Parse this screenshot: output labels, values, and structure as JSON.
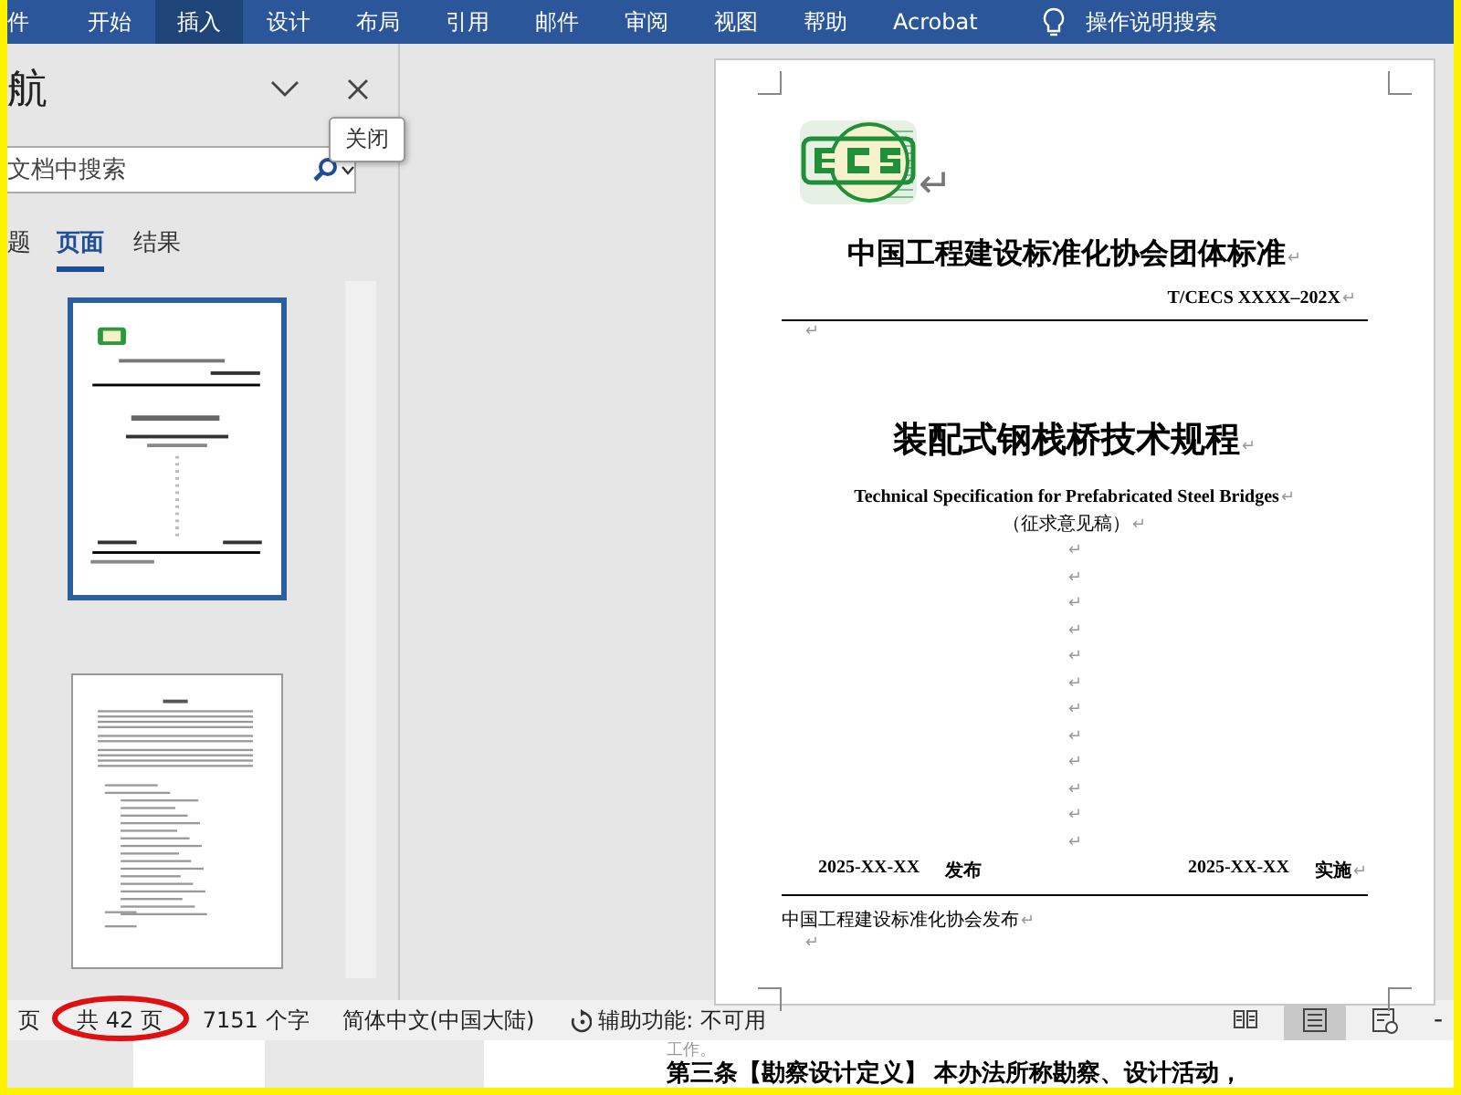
{
  "ribbon": {
    "tabs": [
      {
        "label": "件",
        "selected": false
      },
      {
        "label": "开始",
        "selected": false
      },
      {
        "label": "插入",
        "selected": true
      },
      {
        "label": "设计",
        "selected": false
      },
      {
        "label": "布局",
        "selected": false
      },
      {
        "label": "引用",
        "selected": false
      },
      {
        "label": "邮件",
        "selected": false
      },
      {
        "label": "审阅",
        "selected": false
      },
      {
        "label": "视图",
        "selected": false
      },
      {
        "label": "帮助",
        "selected": false
      },
      {
        "label": "Acrobat",
        "selected": false
      }
    ],
    "tell_me": "操作说明搜索"
  },
  "navigation": {
    "title": "航",
    "tooltip": "关闭",
    "search": {
      "placeholder": "文档中搜索"
    },
    "tabs": [
      {
        "label": "题",
        "selected": false
      },
      {
        "label": "页面",
        "selected": true
      },
      {
        "label": "结果",
        "selected": false
      }
    ],
    "thumbnails": [
      {
        "kind": "cover",
        "selected": true
      },
      {
        "kind": "text",
        "selected": false
      }
    ]
  },
  "document": {
    "paragraphs": [
      {
        "kind": "logo",
        "mark": "↵"
      },
      {
        "kind": "org",
        "text": "中国工程建设标准化协会团体标准",
        "mark": "↵"
      },
      {
        "kind": "code",
        "text": "T/CECS XXXX–202X",
        "mark": "↵"
      },
      {
        "kind": "rule"
      },
      {
        "kind": "left",
        "mark": "↵"
      },
      {
        "kind": "title",
        "text": "装配式钢栈桥技术规程",
        "mark": "↵"
      },
      {
        "kind": "subtitle",
        "text": "Technical Specification for Prefabricated Steel Bridges",
        "mark": "↵"
      },
      {
        "kind": "note",
        "text": "（征求意见稿）",
        "mark": "↵"
      },
      {
        "kind": "empty",
        "mark": "↵"
      },
      {
        "kind": "empty",
        "mark": "↵"
      },
      {
        "kind": "empty",
        "mark": "↵"
      },
      {
        "kind": "empty",
        "mark": "↵"
      },
      {
        "kind": "empty",
        "mark": "↵"
      },
      {
        "kind": "empty",
        "mark": "↵"
      },
      {
        "kind": "empty",
        "mark": "↵"
      },
      {
        "kind": "empty",
        "mark": "↵"
      },
      {
        "kind": "empty",
        "mark": "↵"
      },
      {
        "kind": "empty",
        "mark": "↵"
      },
      {
        "kind": "empty",
        "mark": "↵"
      },
      {
        "kind": "empty",
        "mark": "↵"
      },
      {
        "kind": "dates",
        "parts": [
          "2025-XX-XX",
          "发布",
          "2025-XX-XX",
          "实施"
        ],
        "mark": "↵"
      },
      {
        "kind": "rule"
      },
      {
        "kind": "publisher",
        "text": "中国工程建设标准化协会发布",
        "mark": "↵"
      },
      {
        "kind": "left",
        "mark": "↵"
      }
    ]
  },
  "status_bar": {
    "items": [
      {
        "text": "页",
        "circled": false
      },
      {
        "text": "共 42 页",
        "circled": true
      },
      {
        "text": "7151 个字",
        "circled": false
      },
      {
        "text": "简体中文(中国大陆)",
        "circled": false
      },
      {
        "kind": "accessibility",
        "text": "辅助功能: 不可用",
        "circled": false
      }
    ],
    "views": [
      {
        "kind": "read",
        "selected": false
      },
      {
        "kind": "print",
        "selected": true
      },
      {
        "kind": "web",
        "selected": false
      }
    ],
    "zoom_out": "-"
  },
  "behind": {
    "fragment": "工作。",
    "text": "第三条【勘察设计定义】 本办法所称勘察、设计活动，"
  }
}
